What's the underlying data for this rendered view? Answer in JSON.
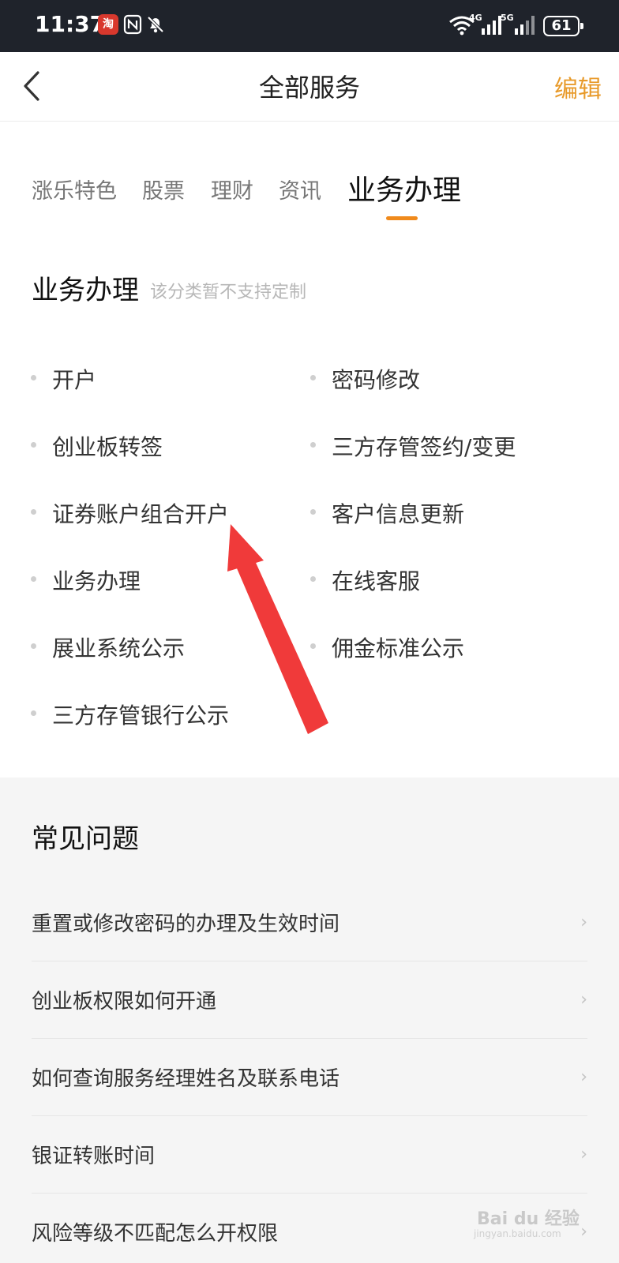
{
  "status": {
    "time": "11:37",
    "app_badge": "淘",
    "net1": "4G",
    "net2": "5G",
    "battery": "61"
  },
  "header": {
    "title": "全部服务",
    "edit_label": "编辑"
  },
  "tabs": [
    {
      "label": "涨乐特色"
    },
    {
      "label": "股票"
    },
    {
      "label": "理财"
    },
    {
      "label": "资讯"
    },
    {
      "label": "业务办理"
    }
  ],
  "active_tab": "业务办理",
  "section": {
    "title": "业务办理",
    "note": "该分类暂不支持定制",
    "items": [
      {
        "label": "开户"
      },
      {
        "label": "密码修改"
      },
      {
        "label": "创业板转签"
      },
      {
        "label": "三方存管签约/变更"
      },
      {
        "label": "证券账户组合开户"
      },
      {
        "label": "客户信息更新"
      },
      {
        "label": "业务办理"
      },
      {
        "label": "在线客服"
      },
      {
        "label": "展业系统公示"
      },
      {
        "label": "佣金标准公示"
      },
      {
        "label": "三方存管银行公示"
      }
    ]
  },
  "faq": {
    "title": "常见问题",
    "items": [
      {
        "label": "重置或修改密码的办理及生效时间"
      },
      {
        "label": "创业板权限如何开通"
      },
      {
        "label": "如何查询服务经理姓名及联系电话"
      },
      {
        "label": "银证转账时间"
      },
      {
        "label": "风险等级不匹配怎么开权限"
      }
    ]
  },
  "watermark": {
    "main": "Bai du 经验",
    "sub": "jingyan.baidu.com"
  },
  "colors": {
    "accent": "#f08a1c",
    "edit": "#e89a2a",
    "status_bar": "#1f232b",
    "annotation_arrow": "#f03a3a"
  }
}
